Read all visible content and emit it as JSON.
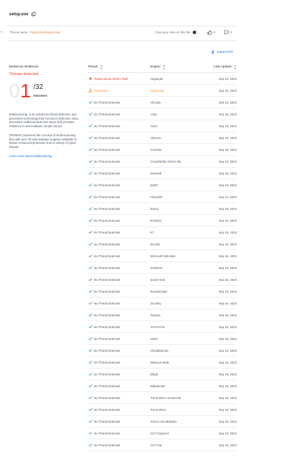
{
  "file": {
    "name": "setup.exe",
    "copy_icon": "copy-icon"
  },
  "threat": {
    "label": "Threat name:",
    "value": "Trojan/Shellcode,Envy"
  },
  "vote": {
    "prompt": "Cast your vote on this file",
    "up_count": "0",
    "down_count": "0"
  },
  "export_label": "Export PDF",
  "multiscan": {
    "title": "Metascan Multiscan",
    "status": "Threats detected",
    "score_leading": "0",
    "score_detected": "1",
    "score_total": "/32",
    "engines_label": "ENGINES",
    "description_1": "Multiscanning, is an advanced threat detection and prevention technology that increases detection rates, decreases outbreak detection times and provides resiliency to anti-malware vendor issues.",
    "description_2": "OPSWAT pioneered the concept of multi-scanning files with over 30 anti-malware engines available to deliver enhanced protection from a variety of cyber threats.",
    "learn_more": "Learn more about Multiscanning."
  },
  "colors": {
    "danger": "#e8362c",
    "warning": "#e8912c",
    "ok": "#2fa84f",
    "link": "#1a6ee8"
  },
  "table": {
    "headers": {
      "result": "Result",
      "engine": "Engine",
      "date": "Last Update"
    },
    "rows": [
      {
        "status": "infected",
        "result": "Trojan.Win32.Shelm.TaaF",
        "engine": "AegisLab",
        "date": "Sep 16, 2023"
      },
      {
        "status": "suspicious",
        "result": "Suspicious",
        "engine": "Kaspersky",
        "date": "Sep 16, 2023"
      },
      {
        "status": "clean",
        "result": "No Threat Detected",
        "engine": "AhnLab",
        "date": "Sep 16, 2023"
      },
      {
        "status": "clean",
        "result": "No Threat Detected",
        "engine": "Antiy",
        "date": "Sep 16, 2023"
      },
      {
        "status": "clean",
        "result": "No Threat Detected",
        "engine": "Avira",
        "date": "Sep 16, 2023"
      },
      {
        "status": "clean",
        "result": "No Threat Detected",
        "engine": "ClamAV",
        "date": "Sep 15, 2023"
      },
      {
        "status": "clean",
        "result": "No Threat Detected",
        "engine": "Comodo",
        "date": "Sep 15, 2023"
      },
      {
        "status": "clean",
        "result": "No Threat Detected",
        "engine": "CrowdStrike Falcon ML",
        "date": "Sep 16, 2023"
      },
      {
        "status": "clean",
        "result": "No Threat Detected",
        "engine": "Emsisoft",
        "date": "Sep 16, 2023"
      },
      {
        "status": "clean",
        "result": "No Threat Detected",
        "engine": "ESET",
        "date": "Sep 16, 2023"
      },
      {
        "status": "clean",
        "result": "No Threat Detected",
        "engine": "Filseclab",
        "date": "Sep 14, 2023"
      },
      {
        "status": "clean",
        "result": "No Threat Detected",
        "engine": "Ikarus",
        "date": "Sep 15, 2023"
      },
      {
        "status": "clean",
        "result": "No Threat Detected",
        "engine": "IKARUS",
        "date": "Sep 16, 2023"
      },
      {
        "status": "clean",
        "result": "No Threat Detected",
        "engine": "K7",
        "date": "Sep 15, 2023"
      },
      {
        "status": "clean",
        "result": "No Threat Detected",
        "engine": "McAfee",
        "date": "Sep 15, 2023"
      },
      {
        "status": "clean",
        "result": "No Threat Detected",
        "engine": "Microsoft Defender",
        "date": "Sep 16, 2023"
      },
      {
        "status": "clean",
        "result": "No Threat Detected",
        "engine": "NANOAV",
        "date": "Sep 16, 2023"
      },
      {
        "status": "clean",
        "result": "No Threat Detected",
        "engine": "Quick Heal",
        "date": "Sep 15, 2023"
      },
      {
        "status": "clean",
        "result": "No Threat Detected",
        "engine": "RocketCyber",
        "date": "Sep 15, 2023"
      },
      {
        "status": "clean",
        "result": "No Threat Detected",
        "engine": "Scrutiny",
        "date": "Sep 16, 2023"
      },
      {
        "status": "clean",
        "result": "No Threat Detected",
        "engine": "Sophos",
        "date": "Sep 16, 2023"
      },
      {
        "status": "clean",
        "result": "No Threat Detected",
        "engine": "TACHYON",
        "date": "Sep 15, 2023"
      },
      {
        "status": "clean",
        "result": "No Threat Detected",
        "engine": "Varist",
        "date": "Sep 16, 2023"
      },
      {
        "status": "clean",
        "result": "No Threat Detected",
        "engine": "VirusBlokAda",
        "date": "Sep 15, 2023"
      },
      {
        "status": "clean",
        "result": "No Threat Detected",
        "engine": "Webroot SMD",
        "date": "Sep 15, 2023"
      },
      {
        "status": "clean",
        "result": "No Threat Detected",
        "engine": "Zillya!",
        "date": "Sep 15, 2023"
      },
      {
        "status": "clean",
        "result": "No Threat Detected",
        "engine": "Bitdefender",
        "date": "Sep 16, 2023"
      },
      {
        "status": "clean",
        "result": "No Threat Detected",
        "engine": "Trend Micro HouseCall",
        "date": "Sep 15, 2023"
      },
      {
        "status": "clean",
        "result": "No Threat Detected",
        "engine": "Trend Micro",
        "date": "Sep 15, 2023"
      },
      {
        "status": "clean",
        "result": "No Threat Detected",
        "engine": "Xvirus Anti-Malware",
        "date": "Sep 15, 2023"
      },
      {
        "status": "clean",
        "result": "No Threat Detected",
        "engine": "Vir.IT Explorer",
        "date": "Sep 15, 2023"
      },
      {
        "status": "clean",
        "result": "No Threat Detected",
        "engine": "Vir.IT ML",
        "date": "Sep 15, 2023"
      }
    ]
  }
}
